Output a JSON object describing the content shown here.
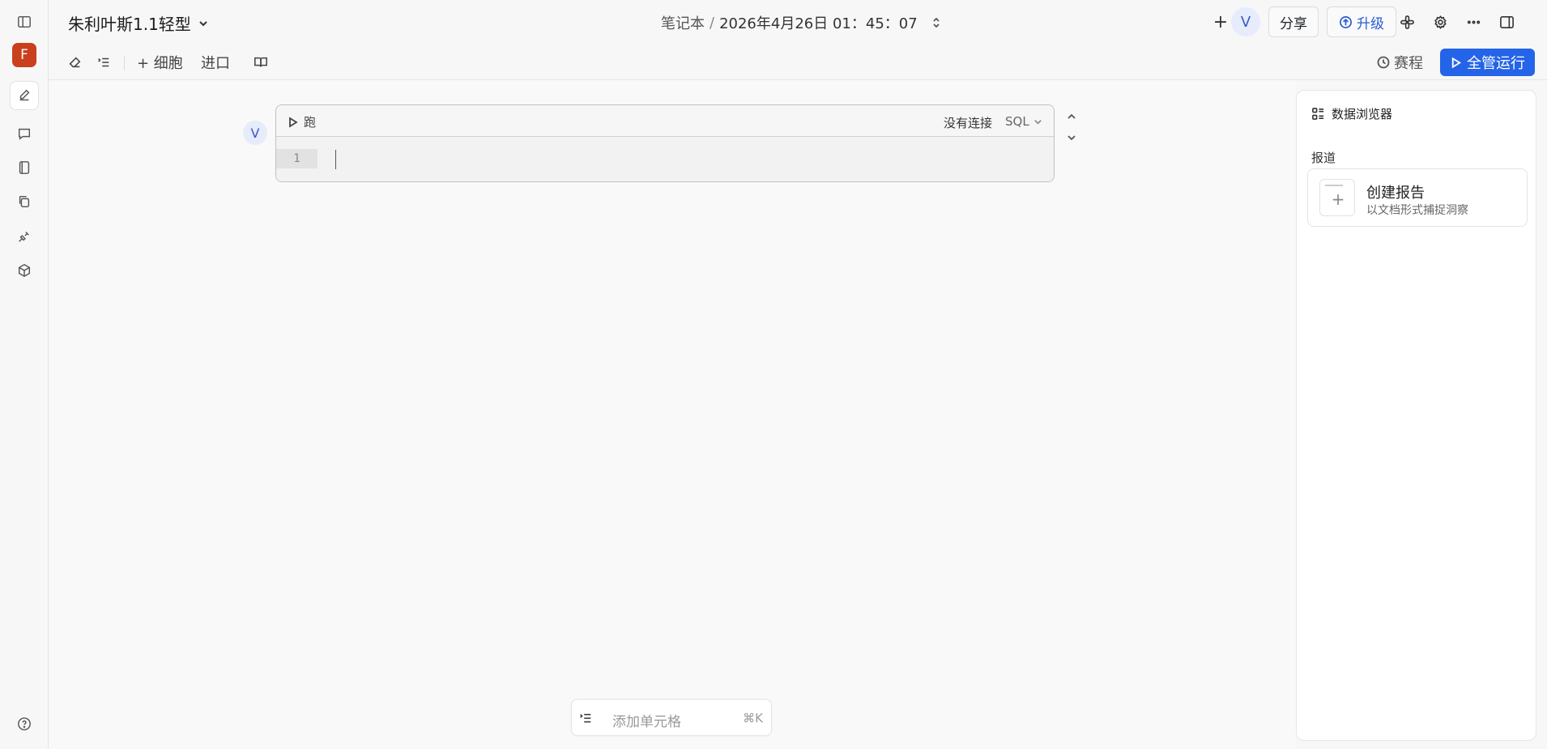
{
  "rail": {
    "avatar_letter": "F",
    "items": [
      "sidebar-toggle-icon",
      "edit-icon",
      "chat-icon",
      "notebook-icon",
      "copy-icon",
      "plug-icon",
      "package-icon"
    ],
    "help_icon": "help-icon"
  },
  "header": {
    "notebook_title": "朱利叶斯1.1轻型",
    "breadcrumb_root": "笔记本",
    "breadcrumb_sep": "/",
    "breadcrumb_time": "2026年4月26日 01：45：07",
    "plus": "+",
    "user_initial": "V",
    "share_label": "分享",
    "upgrade_label": "升级"
  },
  "toolbar": {
    "add_cell_label": "+ 细胞",
    "import_label": "进口",
    "schedule_label": "赛程",
    "run_all_label": "全管运行"
  },
  "cell": {
    "author_initial": "V",
    "run_label": "跑",
    "connection_label": "没有连接",
    "language_label": "SQL",
    "line_number": "1"
  },
  "add_cell_bar": {
    "placeholder": "添加单元格",
    "shortcut": "⌘K"
  },
  "right_panel": {
    "title": "数据浏览器",
    "section_label": "报道",
    "report_title": "创建报告",
    "report_subtitle": "以文档形式捕捉洞察",
    "plus": "+"
  },
  "colors": {
    "accent": "#2464e8",
    "avatar_f": "#c9401c",
    "avatar_v_bg": "#e6ecfb"
  }
}
